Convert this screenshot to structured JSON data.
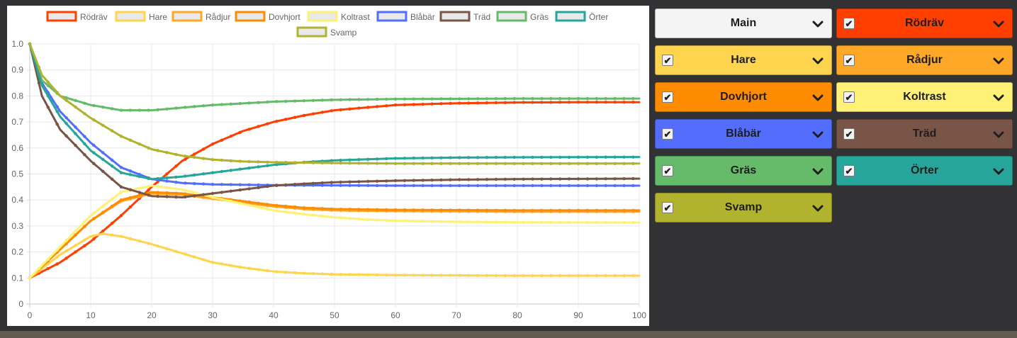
{
  "controls": {
    "main": {
      "label": "Main",
      "color": "#f4f4f4"
    },
    "species": [
      {
        "label": "Rödräv",
        "color": "#ff3f00",
        "checked": true
      },
      {
        "label": "Hare",
        "color": "#ffd54f",
        "checked": true
      },
      {
        "label": "Rådjur",
        "color": "#ffa726",
        "checked": true
      },
      {
        "label": "Dovhjort",
        "color": "#ff8c00",
        "checked": true
      },
      {
        "label": "Koltrast",
        "color": "#fff176",
        "checked": true
      },
      {
        "label": "Blåbär",
        "color": "#536dfe",
        "checked": true
      },
      {
        "label": "Träd",
        "color": "#795548",
        "checked": true
      },
      {
        "label": "Gräs",
        "color": "#66bb6a",
        "checked": true
      },
      {
        "label": "Örter",
        "color": "#26a69a",
        "checked": true
      },
      {
        "label": "Svamp",
        "color": "#b1b32e",
        "checked": true
      }
    ],
    "checkbox_glyph": "✔",
    "icons": {
      "dropdown": "chevron-down-icon"
    }
  },
  "chart_data": {
    "type": "line",
    "xlim": [
      0,
      100
    ],
    "ylim": [
      0,
      1
    ],
    "xticks": [
      0,
      10,
      20,
      30,
      40,
      50,
      60,
      70,
      80,
      90,
      100
    ],
    "yticks": [
      0,
      0.1,
      0.2,
      0.3,
      0.4,
      0.5,
      0.6,
      0.7,
      0.8,
      0.9,
      1.0
    ],
    "ytick_labels": [
      "0",
      "0.1",
      "0.2",
      "0.3",
      "0.4",
      "0.5",
      "0.6",
      "0.7",
      "0.8",
      "0.9",
      "1.0"
    ],
    "grid": true,
    "legend_position": "top",
    "series": [
      {
        "name": "Rödräv",
        "color": "#ff3f00",
        "points": [
          [
            0,
            0.1
          ],
          [
            5,
            0.16
          ],
          [
            10,
            0.24
          ],
          [
            15,
            0.34
          ],
          [
            20,
            0.45
          ],
          [
            25,
            0.55
          ],
          [
            30,
            0.615
          ],
          [
            35,
            0.665
          ],
          [
            40,
            0.7
          ],
          [
            45,
            0.725
          ],
          [
            50,
            0.745
          ],
          [
            55,
            0.755
          ],
          [
            60,
            0.765
          ],
          [
            70,
            0.772
          ],
          [
            80,
            0.775
          ],
          [
            90,
            0.776
          ],
          [
            100,
            0.776
          ]
        ]
      },
      {
        "name": "Hare",
        "color": "#ffd54f",
        "points": [
          [
            0,
            0.1
          ],
          [
            5,
            0.19
          ],
          [
            10,
            0.26
          ],
          [
            12,
            0.27
          ],
          [
            15,
            0.26
          ],
          [
            20,
            0.23
          ],
          [
            25,
            0.195
          ],
          [
            30,
            0.16
          ],
          [
            35,
            0.14
          ],
          [
            40,
            0.125
          ],
          [
            45,
            0.118
          ],
          [
            50,
            0.114
          ],
          [
            60,
            0.111
          ],
          [
            70,
            0.11
          ],
          [
            80,
            0.109
          ],
          [
            100,
            0.109
          ]
        ]
      },
      {
        "name": "Rådjur",
        "color": "#ffa726",
        "points": [
          [
            0,
            0.1
          ],
          [
            5,
            0.21
          ],
          [
            10,
            0.32
          ],
          [
            15,
            0.395
          ],
          [
            20,
            0.425
          ],
          [
            25,
            0.42
          ],
          [
            30,
            0.405
          ],
          [
            35,
            0.39
          ],
          [
            40,
            0.375
          ],
          [
            45,
            0.365
          ],
          [
            50,
            0.36
          ],
          [
            60,
            0.357
          ],
          [
            70,
            0.356
          ],
          [
            80,
            0.355
          ],
          [
            100,
            0.355
          ]
        ]
      },
      {
        "name": "Dovhjort",
        "color": "#ff8c00",
        "points": [
          [
            0,
            0.1
          ],
          [
            5,
            0.21
          ],
          [
            10,
            0.32
          ],
          [
            15,
            0.4
          ],
          [
            20,
            0.43
          ],
          [
            25,
            0.425
          ],
          [
            30,
            0.41
          ],
          [
            35,
            0.395
          ],
          [
            40,
            0.38
          ],
          [
            45,
            0.37
          ],
          [
            50,
            0.365
          ],
          [
            60,
            0.362
          ],
          [
            70,
            0.361
          ],
          [
            80,
            0.36
          ],
          [
            100,
            0.36
          ]
        ]
      },
      {
        "name": "Koltrast",
        "color": "#fff176",
        "points": [
          [
            0,
            0.1
          ],
          [
            5,
            0.22
          ],
          [
            10,
            0.34
          ],
          [
            15,
            0.43
          ],
          [
            20,
            0.455
          ],
          [
            25,
            0.44
          ],
          [
            30,
            0.41
          ],
          [
            35,
            0.385
          ],
          [
            40,
            0.36
          ],
          [
            45,
            0.345
          ],
          [
            50,
            0.333
          ],
          [
            55,
            0.325
          ],
          [
            60,
            0.32
          ],
          [
            70,
            0.316
          ],
          [
            80,
            0.314
          ],
          [
            100,
            0.313
          ]
        ]
      },
      {
        "name": "Blåbär",
        "color": "#536dfe",
        "points": [
          [
            0,
            1.0
          ],
          [
            2,
            0.85
          ],
          [
            5,
            0.74
          ],
          [
            10,
            0.62
          ],
          [
            15,
            0.525
          ],
          [
            20,
            0.48
          ],
          [
            25,
            0.465
          ],
          [
            30,
            0.46
          ],
          [
            40,
            0.457
          ],
          [
            50,
            0.456
          ],
          [
            60,
            0.455
          ],
          [
            80,
            0.455
          ],
          [
            100,
            0.455
          ]
        ]
      },
      {
        "name": "Träd",
        "color": "#795548",
        "points": [
          [
            0,
            1.0
          ],
          [
            2,
            0.8
          ],
          [
            5,
            0.67
          ],
          [
            10,
            0.55
          ],
          [
            15,
            0.45
          ],
          [
            20,
            0.415
          ],
          [
            25,
            0.41
          ],
          [
            30,
            0.425
          ],
          [
            35,
            0.44
          ],
          [
            40,
            0.455
          ],
          [
            45,
            0.462
          ],
          [
            50,
            0.468
          ],
          [
            60,
            0.474
          ],
          [
            70,
            0.478
          ],
          [
            80,
            0.48
          ],
          [
            100,
            0.482
          ]
        ]
      },
      {
        "name": "Gräs",
        "color": "#66bb6a",
        "points": [
          [
            0,
            1.0
          ],
          [
            2,
            0.86
          ],
          [
            5,
            0.8
          ],
          [
            10,
            0.765
          ],
          [
            15,
            0.745
          ],
          [
            20,
            0.745
          ],
          [
            25,
            0.755
          ],
          [
            30,
            0.765
          ],
          [
            40,
            0.778
          ],
          [
            50,
            0.785
          ],
          [
            60,
            0.788
          ],
          [
            80,
            0.79
          ],
          [
            100,
            0.79
          ]
        ]
      },
      {
        "name": "Örter",
        "color": "#26a69a",
        "points": [
          [
            0,
            1.0
          ],
          [
            2,
            0.84
          ],
          [
            5,
            0.72
          ],
          [
            10,
            0.59
          ],
          [
            15,
            0.505
          ],
          [
            20,
            0.48
          ],
          [
            25,
            0.49
          ],
          [
            30,
            0.505
          ],
          [
            35,
            0.52
          ],
          [
            40,
            0.535
          ],
          [
            45,
            0.545
          ],
          [
            50,
            0.552
          ],
          [
            60,
            0.56
          ],
          [
            70,
            0.563
          ],
          [
            80,
            0.564
          ],
          [
            100,
            0.565
          ]
        ]
      },
      {
        "name": "Svamp",
        "color": "#b1b32e",
        "points": [
          [
            0,
            1.0
          ],
          [
            2,
            0.88
          ],
          [
            5,
            0.8
          ],
          [
            10,
            0.715
          ],
          [
            15,
            0.645
          ],
          [
            20,
            0.595
          ],
          [
            25,
            0.57
          ],
          [
            30,
            0.555
          ],
          [
            35,
            0.548
          ],
          [
            40,
            0.545
          ],
          [
            50,
            0.542
          ],
          [
            60,
            0.54
          ],
          [
            80,
            0.54
          ],
          [
            100,
            0.54
          ]
        ]
      }
    ]
  }
}
